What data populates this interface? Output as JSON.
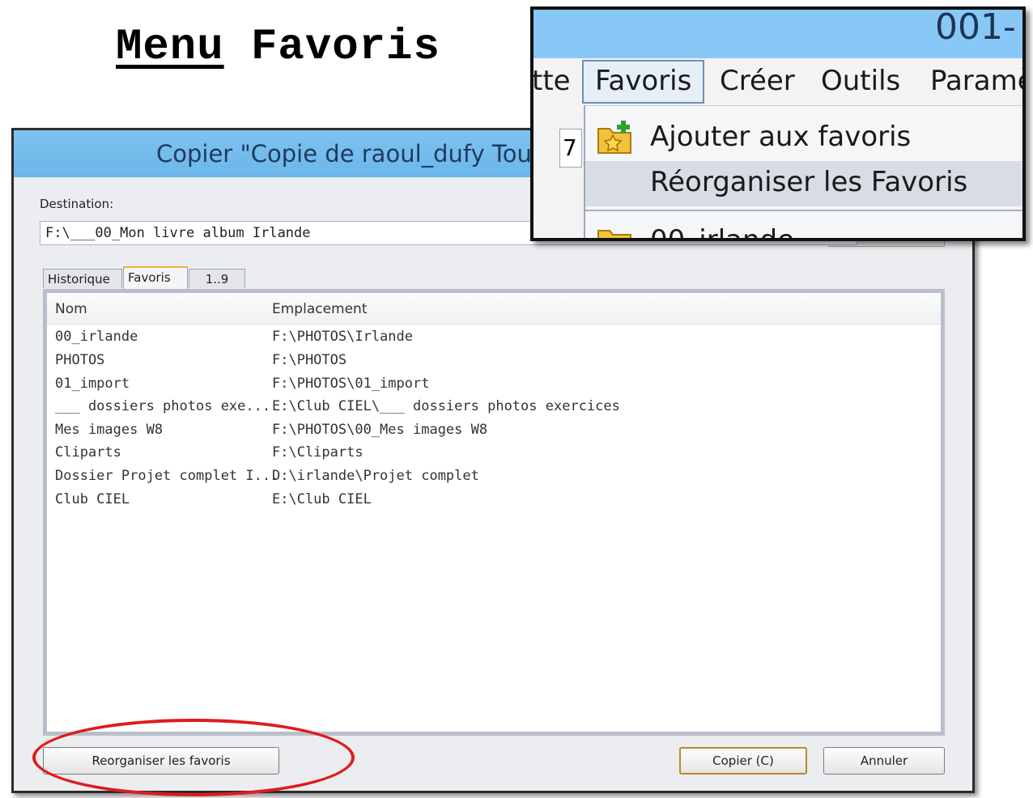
{
  "slide": {
    "title_underlined": "Menu",
    "title_rest": " Favoris"
  },
  "dialog": {
    "title": "Copier \"Copie de raoul_dufy Tou",
    "destination_label": "Destination:",
    "destination_value": "F:\\___00_Mon livre album Irlande",
    "tabs": [
      {
        "label": "Historique",
        "active": false
      },
      {
        "label": "Favoris",
        "active": true
      },
      {
        "label": "1..9",
        "active": false
      }
    ],
    "columns": {
      "name": "Nom",
      "location": "Emplacement"
    },
    "rows": [
      {
        "name": "00_irlande",
        "location": "F:\\PHOTOS\\Irlande"
      },
      {
        "name": "PHOTOS",
        "location": "F:\\PHOTOS"
      },
      {
        "name": "01_import",
        "location": "F:\\PHOTOS\\01_import"
      },
      {
        "name": "___ dossiers photos exe...",
        "location": "E:\\Club CIEL\\___ dossiers photos exercices"
      },
      {
        "name": "Mes images W8",
        "location": "F:\\PHOTOS\\00_Mes images W8"
      },
      {
        "name": "Cliparts",
        "location": "F:\\Cliparts"
      },
      {
        "name": "Dossier Projet complet I...",
        "location": "D:\\irlande\\Projet complet"
      },
      {
        "name": "Club CIEL",
        "location": "E:\\Club CIEL"
      }
    ],
    "buttons": {
      "reorganize": "Reorganiser les favoris",
      "copy": "Copier (C)",
      "cancel": "Annuler"
    }
  },
  "menu_inset": {
    "window_title": "001-",
    "menubar": [
      "tte",
      "Favoris",
      "Créer",
      "Outils",
      "Paramè"
    ],
    "open_menu": "Favoris",
    "behind_value": "7",
    "items": [
      {
        "label": "Ajouter aux favoris",
        "icon": "star-folder-add-icon",
        "hover": false
      },
      {
        "label": "Réorganiser les Favoris",
        "icon": "",
        "hover": true
      },
      {
        "label": "00_irlande",
        "icon": "folder-icon",
        "hover": false
      }
    ]
  },
  "colors": {
    "titlebar": "#6bb6ea",
    "highlight_ellipse": "#e01b1b",
    "default_button_border": "#b58d24"
  }
}
